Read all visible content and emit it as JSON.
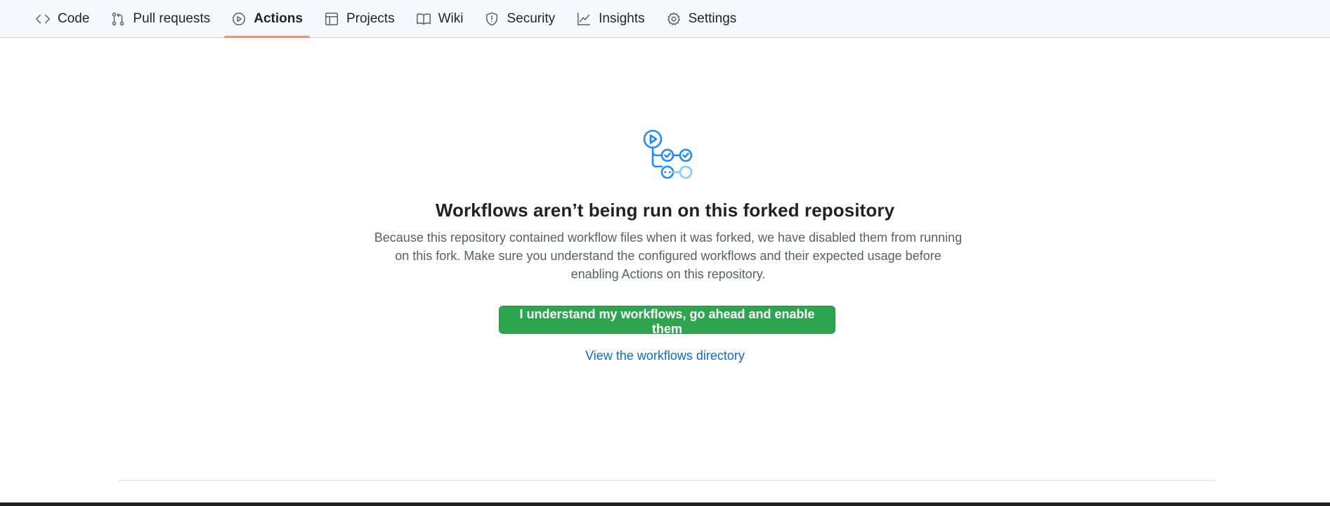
{
  "nav": {
    "tabs": [
      {
        "label": "Code",
        "icon": "code-icon",
        "active": false
      },
      {
        "label": "Pull requests",
        "icon": "git-pull-request-icon",
        "active": false
      },
      {
        "label": "Actions",
        "icon": "play-icon",
        "active": true
      },
      {
        "label": "Projects",
        "icon": "table-icon",
        "active": false
      },
      {
        "label": "Wiki",
        "icon": "book-icon",
        "active": false
      },
      {
        "label": "Security",
        "icon": "shield-icon",
        "active": false
      },
      {
        "label": "Insights",
        "icon": "graph-icon",
        "active": false
      },
      {
        "label": "Settings",
        "icon": "gear-icon",
        "active": false
      }
    ]
  },
  "main": {
    "illustration_icon": "workflow-illustration-icon",
    "title": "Workflows aren’t being run on this forked repository",
    "description": "Because this repository contained workflow files when it was forked, we have disabled them from running on this fork. Make sure you understand the configured workflows and their expected usage before enabling Actions on this repository.",
    "enable_button_label": "I understand my workflows, go ahead and enable them",
    "workflows_link_label": "View the workflows directory"
  },
  "colors": {
    "accent_green": "#2da44e",
    "link_blue": "#0969da",
    "active_tab_underline": "#fd8c73",
    "illustration_blue": "#218bff"
  }
}
